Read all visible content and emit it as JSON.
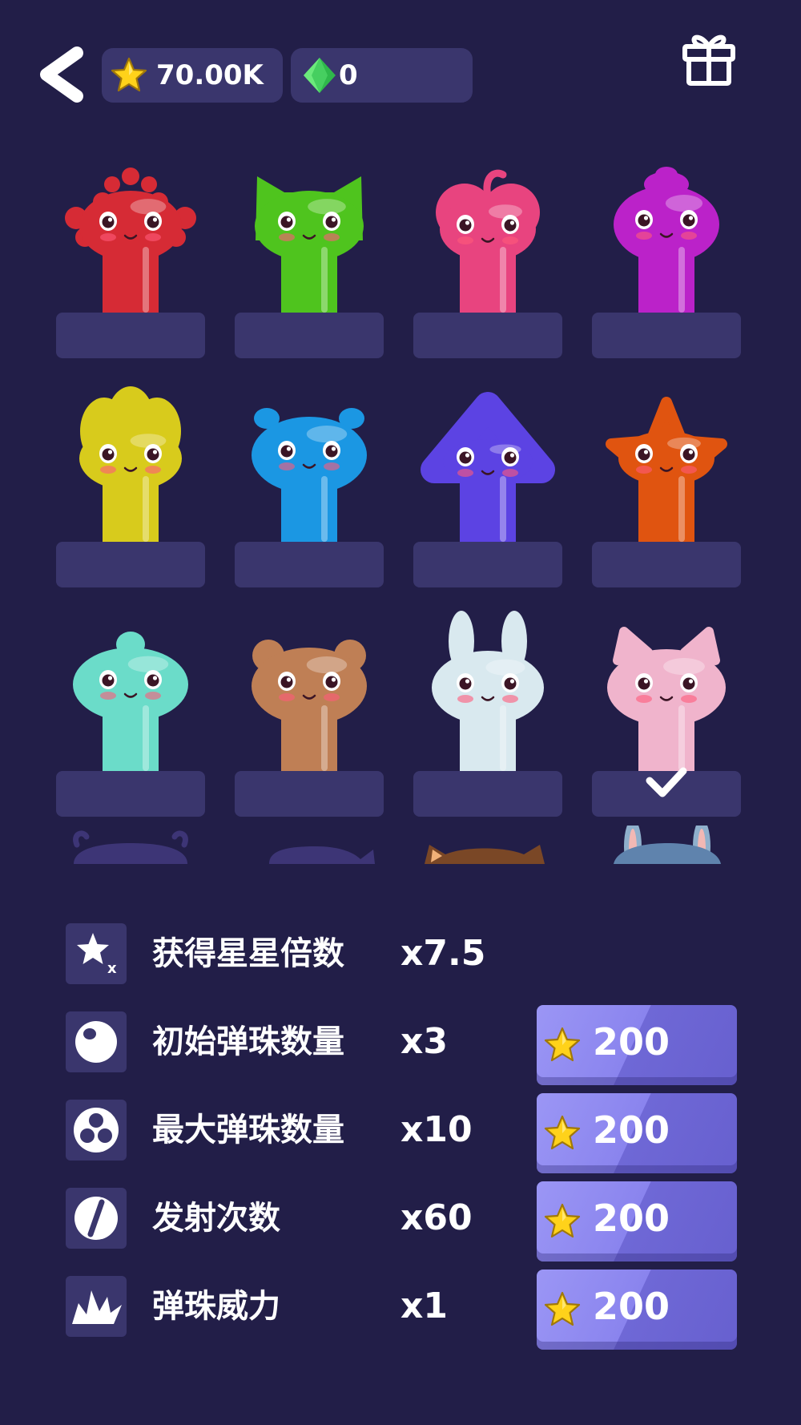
{
  "header": {
    "stars_value": "70.00K",
    "gems_value": "0",
    "back_icon": "chevron-left-icon",
    "gift_icon": "gift-icon"
  },
  "characters": [
    {
      "name": "red-spiky",
      "color": "#d62b35",
      "selected": false
    },
    {
      "name": "green-cat",
      "color": "#4fc41e",
      "selected": false
    },
    {
      "name": "pink-heart",
      "color": "#e8447f",
      "selected": false
    },
    {
      "name": "purple-drop",
      "color": "#bb22c9",
      "selected": false
    },
    {
      "name": "yellow-tulip",
      "color": "#d8cb1c",
      "selected": false
    },
    {
      "name": "blue-antenna",
      "color": "#1b97e3",
      "selected": false
    },
    {
      "name": "violet-cone",
      "color": "#5c43e3",
      "selected": false
    },
    {
      "name": "orange-star",
      "color": "#e05410",
      "selected": false
    },
    {
      "name": "teal-blob",
      "color": "#6bdcc9",
      "selected": false
    },
    {
      "name": "brown-bear",
      "color": "#bf7f55",
      "selected": false
    },
    {
      "name": "white-bunny",
      "color": "#d9e9ef",
      "selected": false
    },
    {
      "name": "pink-pig",
      "color": "#f0b4cc",
      "selected": true
    }
  ],
  "stats": [
    {
      "label": "获得星星倍数",
      "value": "x7.5",
      "icon": "star-multiplier-icon",
      "upgradable": false
    },
    {
      "label": "初始弹珠数量",
      "value": "x3",
      "icon": "ball-icon",
      "upgradable": true,
      "cost": "200"
    },
    {
      "label": "最大弹珠数量",
      "value": "x10",
      "icon": "three-balls-icon",
      "upgradable": true,
      "cost": "200"
    },
    {
      "label": "发射次数",
      "value": "x60",
      "icon": "launch-count-icon",
      "upgradable": true,
      "cost": "200"
    },
    {
      "label": "弹珠威力",
      "value": "x1",
      "icon": "power-burst-icon",
      "upgradable": true,
      "cost": "200"
    }
  ],
  "colors": {
    "background": "#221e48",
    "panel": "#3a366d",
    "button": "#7a73e0",
    "star": "#ffd21a",
    "gem": "#3ed35a"
  }
}
